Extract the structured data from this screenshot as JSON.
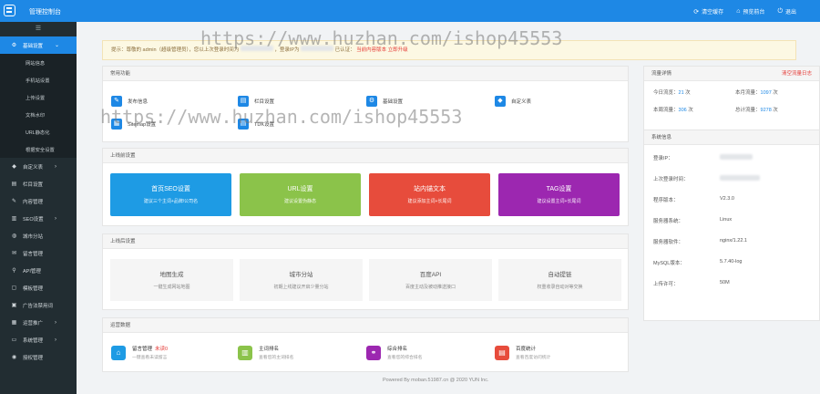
{
  "header": {
    "title": "管理控制台",
    "actions": [
      {
        "icon": "refresh-icon",
        "glyph": "⟳",
        "label": "清空缓存"
      },
      {
        "icon": "home-icon",
        "glyph": "⌂",
        "label": "预览前台"
      },
      {
        "icon": "logout-icon",
        "glyph": "⏻",
        "label": "退出"
      }
    ]
  },
  "sidebar": {
    "toggle_glyph": "☰",
    "active": {
      "icon": "gear-icon",
      "glyph": "⚙",
      "label": "基础设置",
      "arrow": "⌄"
    },
    "sub_items": [
      "网站信息",
      "手机站设置",
      "上传设置",
      "文档水印",
      "URL静态化",
      "根据安全设置"
    ],
    "items": [
      {
        "name": "custom",
        "glyph": "◆",
        "label": "自定义表",
        "arrow": "›"
      },
      {
        "name": "column",
        "glyph": "▤",
        "label": "栏目设置",
        "arrow": ""
      },
      {
        "name": "content",
        "glyph": "✎",
        "label": "内容管理",
        "arrow": ""
      },
      {
        "name": "seo",
        "glyph": "▥",
        "label": "SEO设置",
        "arrow": "›"
      },
      {
        "name": "city",
        "glyph": "◍",
        "label": "城市分站",
        "arrow": ""
      },
      {
        "name": "message",
        "glyph": "✉",
        "label": "留言管理",
        "arrow": ""
      },
      {
        "name": "api",
        "glyph": "⚲",
        "label": "API管理",
        "arrow": ""
      },
      {
        "name": "template",
        "glyph": "▢",
        "label": "模板管理",
        "arrow": ""
      },
      {
        "name": "ads",
        "glyph": "▣",
        "label": "广告法禁用词",
        "arrow": ""
      },
      {
        "name": "ops",
        "glyph": "▦",
        "label": "运营推广",
        "arrow": "›"
      },
      {
        "name": "system",
        "glyph": "▭",
        "label": "系统管理",
        "arrow": "›"
      },
      {
        "name": "auth",
        "glyph": "◉",
        "label": "授权管理",
        "arrow": ""
      }
    ]
  },
  "notice": {
    "prefix": "提示：尊敬的 admin（超级管理员），您以上次登录时间为",
    "mid": "，登录IP为",
    "auth": "已认证：",
    "red": "当前内容版本 立即升级"
  },
  "quick": {
    "title": "常用功能",
    "items": [
      {
        "name": "publish",
        "glyph": "✎",
        "label": "发布信息"
      },
      {
        "name": "column",
        "glyph": "▤",
        "label": "栏目设置"
      },
      {
        "name": "basic",
        "glyph": "⚙",
        "label": "基础设置"
      },
      {
        "name": "custom",
        "glyph": "◆",
        "label": "自定义表"
      },
      {
        "name": "sitemap",
        "glyph": "▦",
        "label": "Sitemap设置"
      },
      {
        "name": "tdk",
        "glyph": "▤",
        "label": "TDK设置"
      }
    ]
  },
  "pre_seo": {
    "title": "上线前设置",
    "buttons": [
      {
        "title": "首页SEO设置",
        "sub": "建议三个主词+品牌/公司名",
        "color": "#1e9be4"
      },
      {
        "title": "URL设置",
        "sub": "建议设置伪静态",
        "color": "#8bc34a"
      },
      {
        "title": "站内锚文本",
        "sub": "建议添加主词+长尾词",
        "color": "#e74c3c"
      },
      {
        "title": "TAG设置",
        "sub": "建议设置主词+长尾词",
        "color": "#9c27b0"
      }
    ]
  },
  "post_seo": {
    "title": "上线后设置",
    "items": [
      {
        "title": "地图生成",
        "sub": "一键生成网站地图"
      },
      {
        "title": "城市分站",
        "sub": "初期上线建议开启少量分站"
      },
      {
        "title": "百度API",
        "sub": "百度主动及被动推送接口"
      },
      {
        "title": "自动提链",
        "sub": "权重收录自动对等交换"
      }
    ]
  },
  "ops_data": {
    "title": "运营数据",
    "items": [
      {
        "name": "message",
        "glyph": "⌂",
        "title": "留言管理",
        "badge": "未读0",
        "sub": "一键查看未读留言",
        "color": "#1e9be4"
      },
      {
        "name": "rank",
        "glyph": "▥",
        "title": "主词排名",
        "badge": "",
        "sub": "查看您的主词排名",
        "color": "#8bc34a"
      },
      {
        "name": "rank2",
        "glyph": "⚭",
        "title": "综合排名",
        "badge": "",
        "sub": "查看您的综合排名",
        "color": "#9c27b0"
      },
      {
        "name": "stats",
        "glyph": "▤",
        "title": "百度统计",
        "badge": "",
        "sub": "查看百度访问统计",
        "color": "#e74c3c"
      }
    ]
  },
  "traffic": {
    "title": "流量详情",
    "clear": "清空流量日志",
    "rows": [
      {
        "label": "今日流览：",
        "value": "21",
        "unit": "次"
      },
      {
        "label": "本月流量：",
        "value": "1097",
        "unit": "次"
      },
      {
        "label": "本周流量：",
        "value": "306",
        "unit": "次"
      },
      {
        "label": "总计流量：",
        "value": "9278",
        "unit": "次"
      }
    ]
  },
  "system": {
    "title": "系统信息",
    "rows": [
      {
        "k": "登录IP：",
        "v": ""
      },
      {
        "k": "上次登录时间：",
        "v": ""
      },
      {
        "k": "程序版本：",
        "v": "V2.3.0"
      },
      {
        "k": "服务器系统：",
        "v": "Linux"
      },
      {
        "k": "服务器软件：",
        "v": "nginx/1.22.1"
      },
      {
        "k": "MySQL版本：",
        "v": "5.7.40-log"
      },
      {
        "k": "上传许可：",
        "v": "50M"
      }
    ]
  },
  "footer": "Powered By moban.51987.cn @ 2020 YUN Inc.",
  "watermark": "https://www.huzhan.com/ishop45553"
}
